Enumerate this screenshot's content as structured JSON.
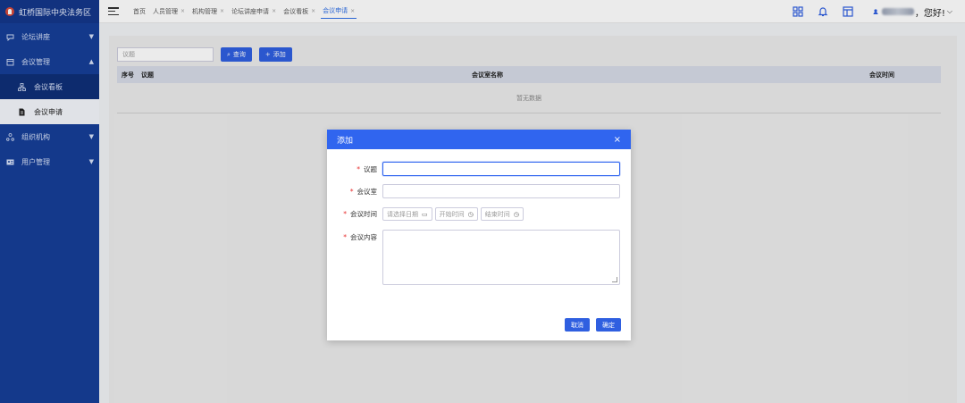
{
  "brand": {
    "title": "虹桥国际中央法务区"
  },
  "sidebar": {
    "items": [
      {
        "label": "论坛讲座",
        "icon": "forum-icon"
      },
      {
        "label": "会议管理",
        "icon": "calendar-icon"
      },
      {
        "label": "会议看板",
        "icon": "org-icon"
      },
      {
        "label": "会议申请",
        "icon": "document-icon"
      },
      {
        "label": "组织机构",
        "icon": "org-icon"
      },
      {
        "label": "用户管理",
        "icon": "user-card-icon"
      }
    ]
  },
  "topbar": {
    "breadcrumbs": [
      {
        "label": "首页"
      },
      {
        "label": "人员管理"
      },
      {
        "label": "机构管理"
      },
      {
        "label": "论坛讲座申请"
      },
      {
        "label": "会议看板"
      },
      {
        "label": "会议申请"
      }
    ],
    "greeting": "，您好!"
  },
  "main": {
    "search_placeholder": "议题",
    "query_label": "查询",
    "add_label": "添加",
    "columns": [
      "序号",
      "议题",
      "会议室名称",
      "会议时间"
    ],
    "empty_text": "暂无数据"
  },
  "modal": {
    "title": "添加",
    "close": "×",
    "fields": {
      "topic_label": "议题",
      "room_label": "会议室",
      "time_label": "会议时间",
      "content_label": "会议内容",
      "date_placeholder": "请选择日期",
      "start_placeholder": "开始时间",
      "end_placeholder": "结束时间"
    },
    "cancel_label": "取消",
    "confirm_label": "确定"
  },
  "colors": {
    "sidebar": "#163e97",
    "primary": "#2f5fe0",
    "modal_header": "#3065ef",
    "required": "#e63030"
  }
}
